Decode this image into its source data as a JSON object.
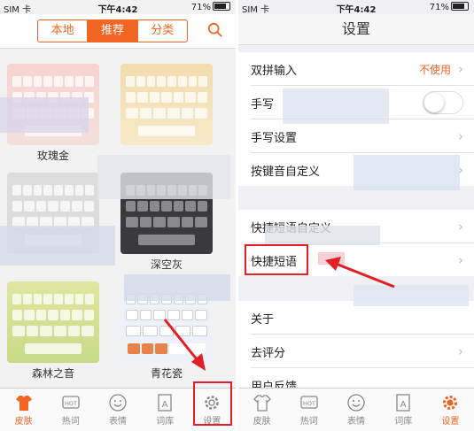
{
  "left": {
    "status": {
      "carrier": "SIM 卡",
      "time": "下午4:42",
      "battery": "71%"
    },
    "tabs": [
      {
        "label": "本地",
        "active": false
      },
      {
        "label": "推荐",
        "active": true
      },
      {
        "label": "分类",
        "active": false
      }
    ],
    "themes": [
      "玫瑰金",
      "深空灰",
      "森林之音",
      "青花瓷"
    ],
    "bottom_tabs": [
      {
        "label": "皮肤",
        "icon": "shirt-icon",
        "active": true
      },
      {
        "label": "热词",
        "icon": "hot-icon",
        "active": false
      },
      {
        "label": "表情",
        "icon": "smiley-icon",
        "active": false
      },
      {
        "label": "词库",
        "icon": "dictionary-icon",
        "active": false
      },
      {
        "label": "设置",
        "icon": "gear-icon",
        "active": false
      }
    ]
  },
  "right": {
    "status": {
      "carrier": "SIM 卡",
      "time": "下午4:42",
      "battery": "71%"
    },
    "title": "设置",
    "rows": {
      "double_pinyin": {
        "label": "双拼输入",
        "value": "不使用"
      },
      "handwriting": {
        "label": "手写"
      },
      "handwriting_settings": {
        "label": "手写设置"
      },
      "key_sound": {
        "label": "按键音自定义"
      },
      "quick_phrase_custom": {
        "label": "快捷短语自定义"
      },
      "quick_phrase": {
        "label": "快捷短语"
      },
      "about": {
        "label": "关于"
      },
      "rate": {
        "label": "去评分"
      },
      "feedback": {
        "label": "用户反馈"
      }
    },
    "bottom_tabs": [
      {
        "label": "皮肤",
        "icon": "shirt-icon",
        "active": false
      },
      {
        "label": "热词",
        "icon": "hot-icon",
        "active": false
      },
      {
        "label": "表情",
        "icon": "smiley-icon",
        "active": false
      },
      {
        "label": "词库",
        "icon": "dictionary-icon",
        "active": false
      },
      {
        "label": "设置",
        "icon": "gear-icon",
        "active": true
      }
    ]
  },
  "colors": {
    "accent": "#f26522",
    "highlight": "#e41e25"
  }
}
